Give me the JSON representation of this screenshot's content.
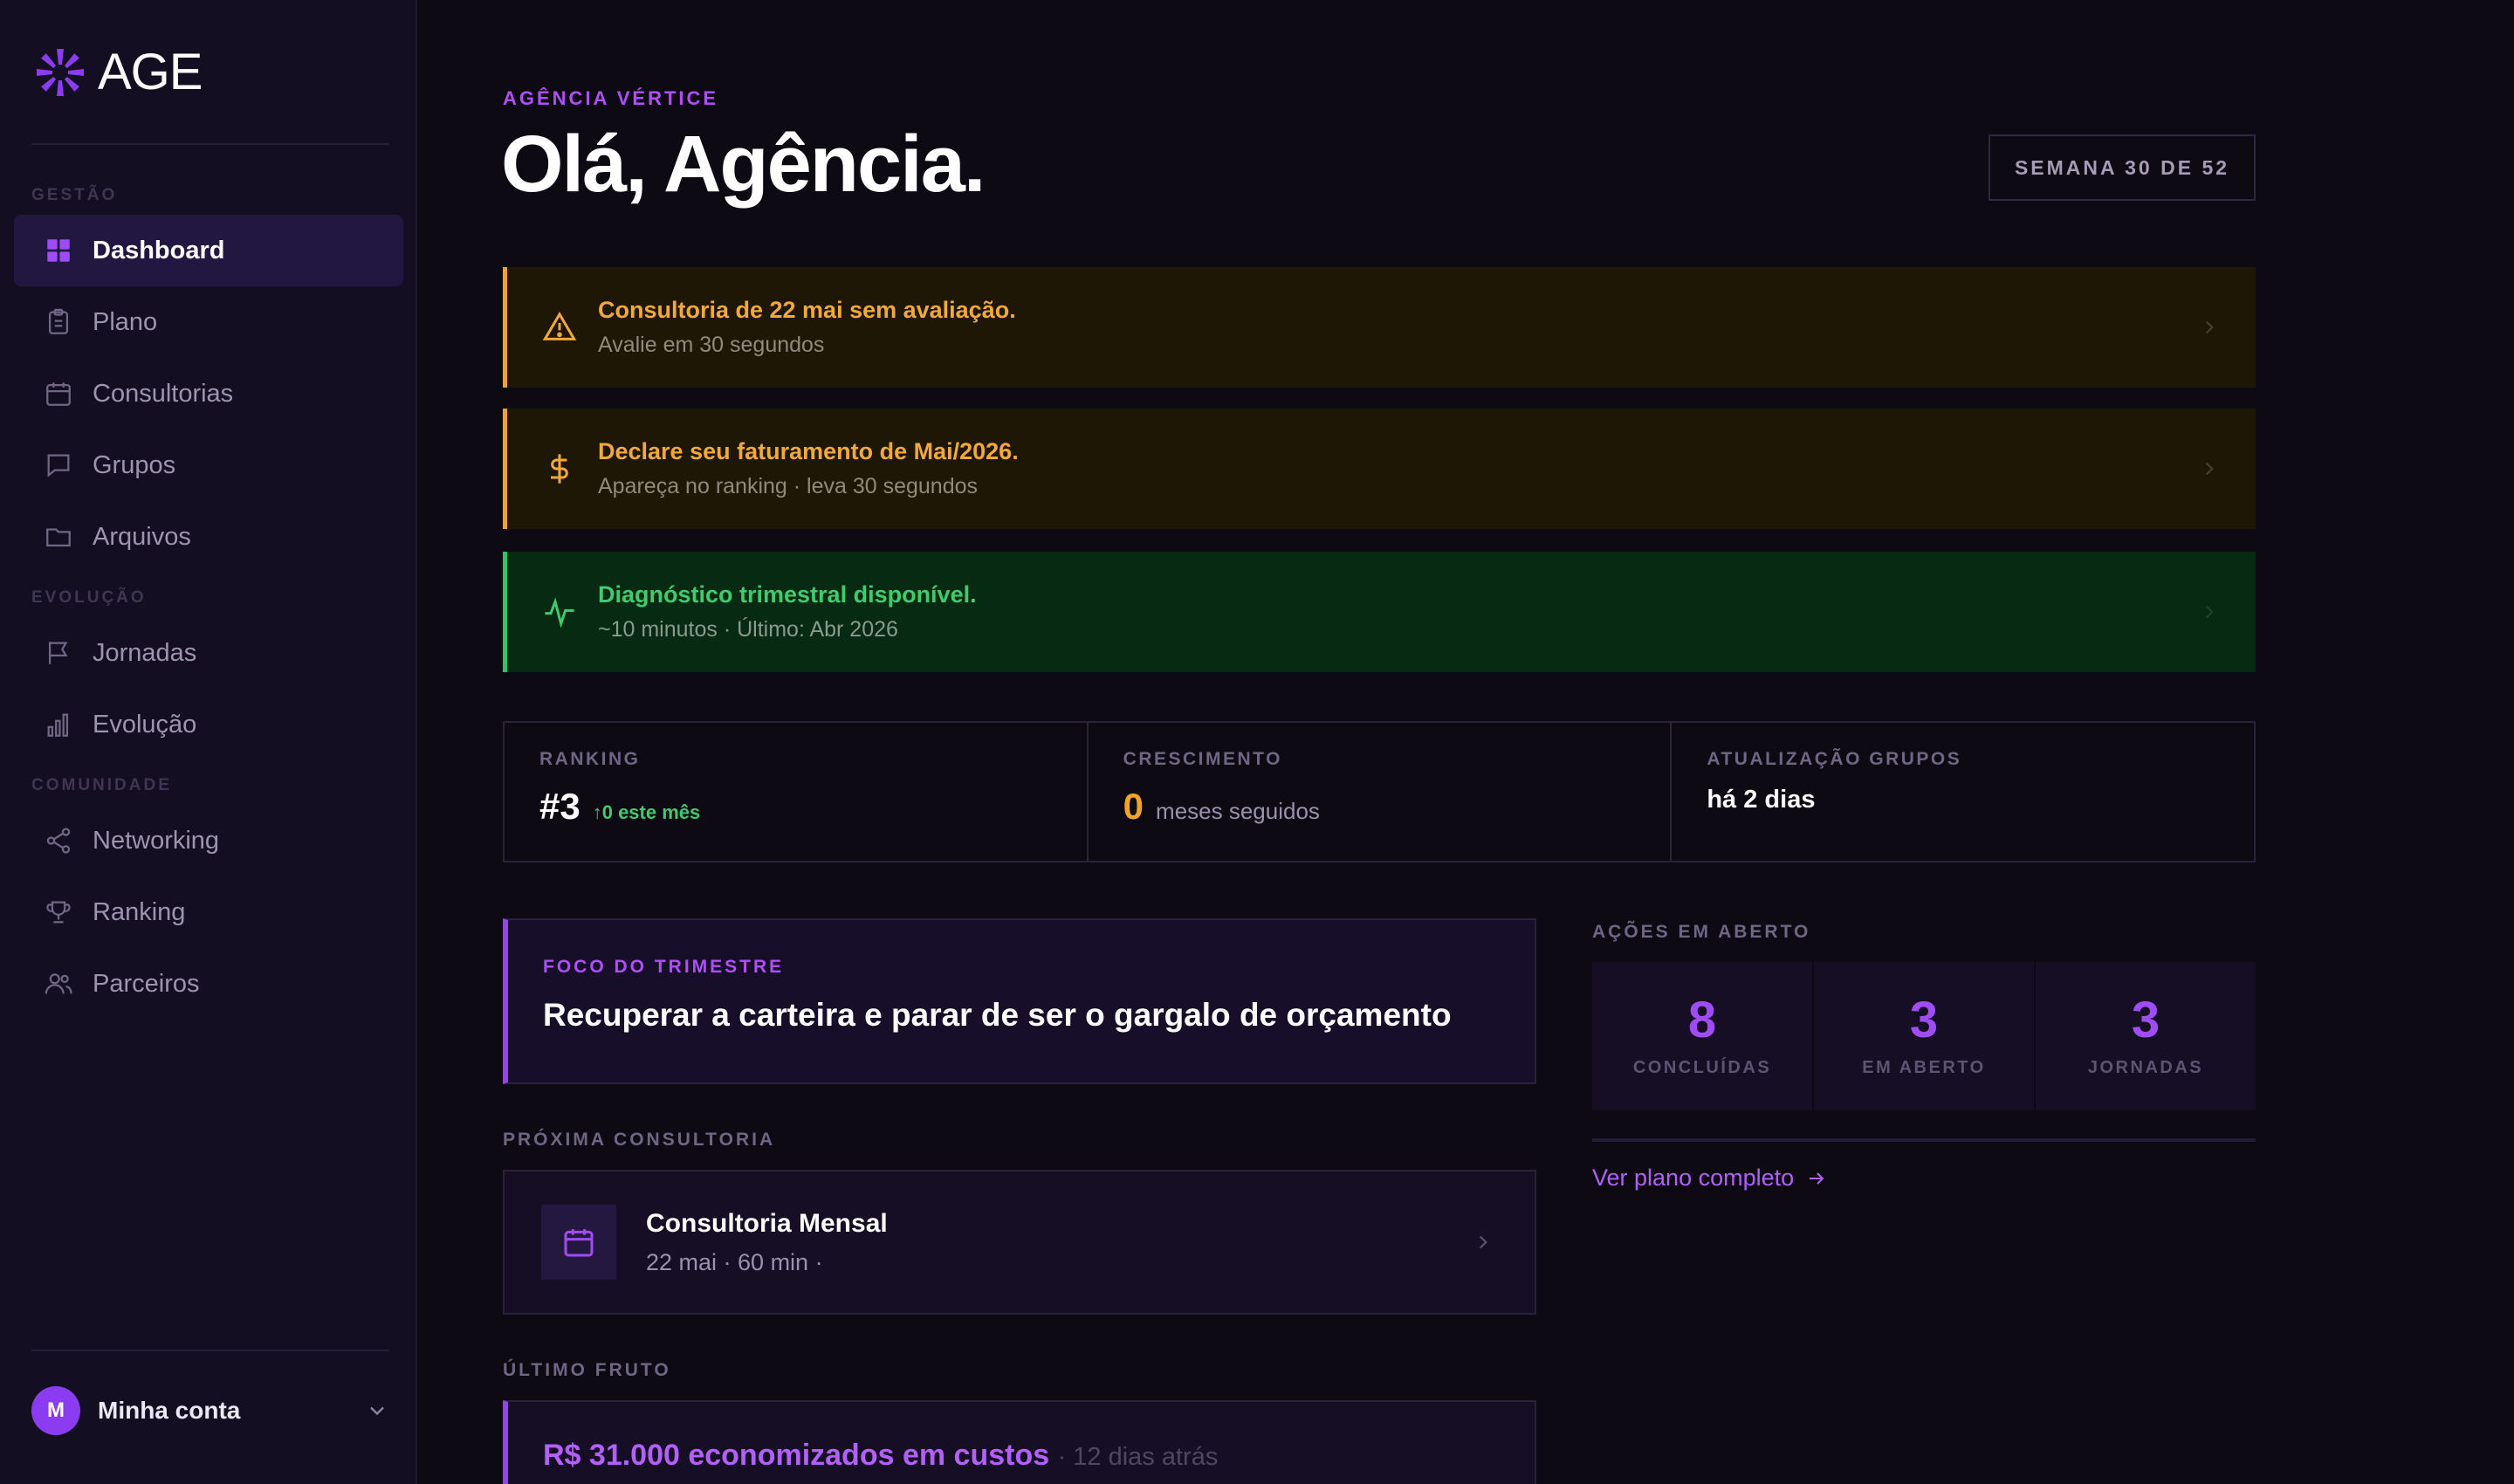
{
  "brand": {
    "name": "AGE"
  },
  "sidebar": {
    "sections": [
      {
        "label": "GESTÃO"
      },
      {
        "label": "EVOLUÇÃO"
      },
      {
        "label": "COMUNIDADE"
      }
    ],
    "items": [
      {
        "label": "Dashboard",
        "icon": "grid-icon",
        "active": true
      },
      {
        "label": "Plano",
        "icon": "clipboard-icon"
      },
      {
        "label": "Consultorias",
        "icon": "calendar-icon"
      },
      {
        "label": "Grupos",
        "icon": "chat-icon"
      },
      {
        "label": "Arquivos",
        "icon": "folder-icon"
      },
      {
        "label": "Jornadas",
        "icon": "flag-icon"
      },
      {
        "label": "Evolução",
        "icon": "bar-chart-icon"
      },
      {
        "label": "Networking",
        "icon": "share-icon"
      },
      {
        "label": "Ranking",
        "icon": "trophy-icon"
      },
      {
        "label": "Parceiros",
        "icon": "users-icon"
      }
    ],
    "account": {
      "initial": "M",
      "label": "Minha conta"
    }
  },
  "header": {
    "eyebrow": "AGÊNCIA VÉRTICE",
    "title": "Olá, Agência.",
    "week_badge": "SEMANA 30 DE 52"
  },
  "alerts": [
    {
      "title": "Consultoria de 22 mai sem avaliação.",
      "sub": "Avalie em 30 segundos",
      "icon": "warning-icon",
      "tone": "warning"
    },
    {
      "title": "Declare seu faturamento de Mai/2026.",
      "sub": "Apareça no ranking · leva 30 segundos",
      "icon": "dollar-icon",
      "tone": "warning"
    },
    {
      "title": "Diagnóstico trimestral disponível.",
      "sub": "~10 minutos · Último: Abr 2026",
      "icon": "activity-icon",
      "tone": "success"
    }
  ],
  "stats": {
    "ranking": {
      "label": "RANKING",
      "value": "#3",
      "delta": "0 este mês"
    },
    "growth": {
      "label": "CRESCIMENTO",
      "value": "0",
      "suffix": "meses seguidos"
    },
    "groups": {
      "label": "ATUALIZAÇÃO GRUPOS",
      "value": "há 2 dias"
    }
  },
  "focus": {
    "eyebrow": "FOCO DO TRIMESTRE",
    "text": "Recuperar a carteira e parar de ser o gargalo de orçamento"
  },
  "next_consult": {
    "label": "PRÓXIMA CONSULTORIA",
    "title": "Consultoria Mensal",
    "sub": "22 mai · 60 min ·"
  },
  "last_fruit": {
    "label": "ÚLTIMO FRUTO",
    "value": "R$ 31.000 economizados em custos",
    "time": "· 12 dias atrás"
  },
  "actions": {
    "label": "AÇÕES EM ABERTO",
    "cells": [
      {
        "num": "8",
        "label": "CONCLUÍDAS"
      },
      {
        "num": "3",
        "label": "EM ABERTO"
      },
      {
        "num": "3",
        "label": "JORNADAS"
      }
    ],
    "link": "Ver plano completo"
  },
  "colors": {
    "accent": "#9b3ff2",
    "warning": "#f2a429",
    "success": "#3fcb6e",
    "background": "#0d0a14",
    "sidebar": "#130e22"
  }
}
